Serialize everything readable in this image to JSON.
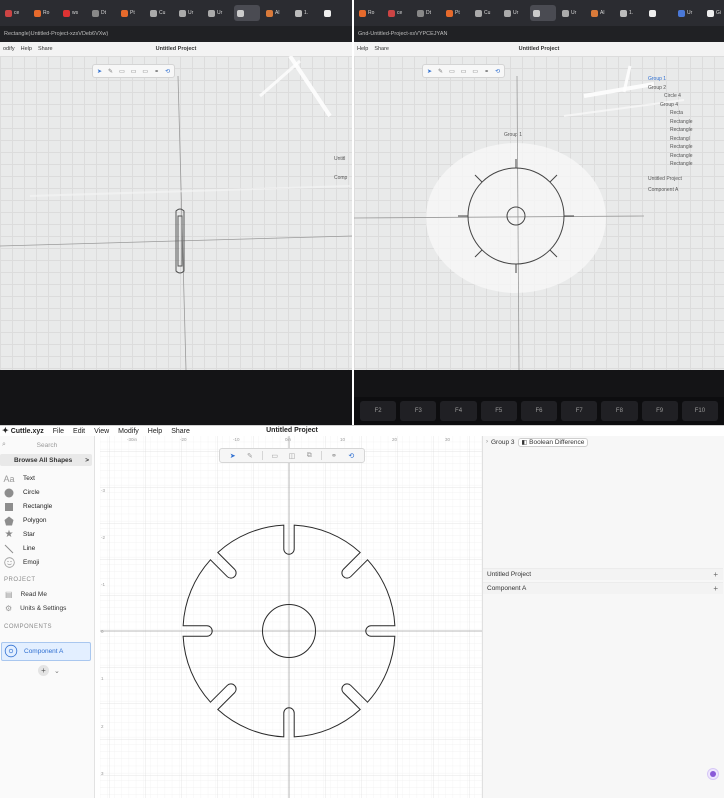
{
  "photo_left": {
    "tabs": [
      "ce",
      "Ro",
      "ws",
      "Dt",
      "Pt",
      "Cu",
      "Ur",
      "Ur",
      "",
      "Al",
      "1.",
      "",
      "Gi",
      "Ur"
    ],
    "url": "Rectangle)Untitled-Project-xzsVDeb6VXw)",
    "menu": [
      "odify",
      "Help",
      "Share"
    ],
    "title": "Untitled Project",
    "side": [
      "Untitl",
      "Comp"
    ]
  },
  "photo_right": {
    "tabs": [
      "Ro",
      "ce",
      "Dt",
      "Pt",
      "Cu",
      "Ur",
      "",
      "Ur",
      "Al",
      "1.",
      "",
      "Ur",
      "Gi"
    ],
    "url": "Gnd-Untitled-Project-xsVYPCEJYAN",
    "menu": [
      "Help",
      "Share"
    ],
    "title": "Untitled Project",
    "group_label": "Group 1",
    "side": [
      "Group 1",
      "Group 2",
      "Circle 4",
      "Group 4",
      "Recta",
      "Rectangle",
      "Rectangle",
      "Rectangl",
      "Rectangle",
      "Rectangle",
      "Rectangle"
    ],
    "side_lower": [
      "Untitled Project",
      "Component A"
    ],
    "keys": [
      "F2",
      "F3",
      "F4",
      "F5",
      "F6",
      "F7",
      "F8",
      "F9",
      "F10"
    ]
  },
  "app": {
    "logo": "Cuttle.xyz",
    "menu": [
      "File",
      "Edit",
      "View",
      "Modify",
      "Help",
      "Share"
    ],
    "project_title": "Untitled Project",
    "search_placeholder": "Search",
    "browse_label": "Browse All Shapes",
    "browse_chevron": ">",
    "shapes": [
      {
        "label": "Text",
        "icon": "text-icon"
      },
      {
        "label": "Circle",
        "icon": "circle-icon"
      },
      {
        "label": "Rectangle",
        "icon": "rectangle-icon"
      },
      {
        "label": "Polygon",
        "icon": "polygon-icon"
      },
      {
        "label": "Star",
        "icon": "star-icon"
      },
      {
        "label": "Line",
        "icon": "line-icon"
      },
      {
        "label": "Emoji",
        "icon": "emoji-icon"
      }
    ],
    "project_section": "PROJECT",
    "project_items": [
      {
        "label": "Read Me",
        "icon": "readme-icon"
      },
      {
        "label": "Units & Settings",
        "icon": "settings-icon"
      }
    ],
    "components_section": "COMPONENTS",
    "component_selected": "Component A",
    "add_symbol": "+",
    "add_chevron": "⌄",
    "breadcrumb": {
      "group": "Group 3",
      "operation": "Boolean Difference"
    },
    "layers": [
      {
        "label": "Untitled Project",
        "plus": "+"
      },
      {
        "label": "Component A",
        "plus": "+"
      }
    ],
    "ruler_top": [
      "-30in",
      "-20",
      "-10",
      "0in",
      "10",
      "20",
      "30"
    ],
    "ruler_left": [
      "-3",
      "-2",
      "-1",
      "0",
      "1",
      "2",
      "3"
    ],
    "accent": "#2f6fd1"
  }
}
